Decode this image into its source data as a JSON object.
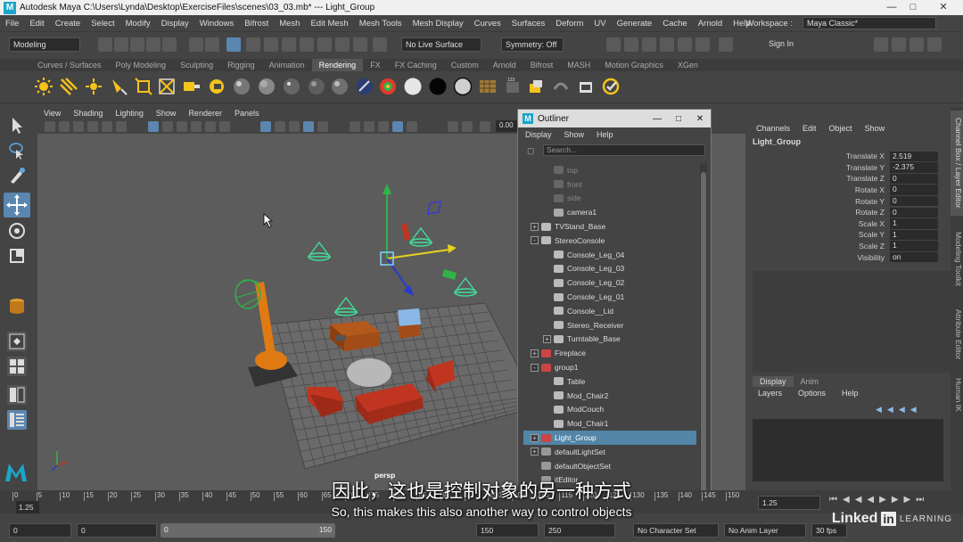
{
  "window": {
    "title": "Autodesk Maya  C:\\Users\\Lynda\\Desktop\\ExerciseFiles\\scenes\\03_03.mb*  ---  Light_Group",
    "logo": "M"
  },
  "menubar": [
    "File",
    "Edit",
    "Create",
    "Select",
    "Modify",
    "Display",
    "Windows",
    "Bifrost",
    "Mesh",
    "Edit Mesh",
    "Mesh Tools",
    "Mesh Display",
    "Curves",
    "Surfaces",
    "Deform",
    "UV",
    "Generate",
    "Cache",
    "Arnold",
    "Help"
  ],
  "workspace": {
    "label": "Workspace :",
    "value": "Maya Classic*"
  },
  "status": {
    "mode": "Modeling",
    "live_surface": "No Live Surface",
    "symmetry": "Symmetry: Off",
    "sign_in": "Sign In"
  },
  "shelf_tabs": [
    "Curves / Surfaces",
    "Poly Modeling",
    "Sculpting",
    "Rigging",
    "Animation",
    "Rendering",
    "FX",
    "FX Caching",
    "Custom",
    "Arnold",
    "Bifrost",
    "MASH",
    "Motion Graphics",
    "XGen"
  ],
  "shelf_active": "Rendering",
  "viewport": {
    "menu": [
      "View",
      "Shading",
      "Lighting",
      "Show",
      "Renderer",
      "Panels"
    ],
    "label": "persp",
    "value": "0.00"
  },
  "outliner": {
    "title": "Outliner",
    "menu": [
      "Display",
      "Show",
      "Help"
    ],
    "search_placeholder": "Search...",
    "items": [
      {
        "label": "top",
        "dim": true,
        "indent": 1
      },
      {
        "label": "front",
        "dim": true,
        "indent": 1
      },
      {
        "label": "side",
        "dim": true,
        "indent": 1
      },
      {
        "label": "camera1",
        "indent": 1
      },
      {
        "label": "TVStand_Base",
        "indent": 0,
        "exp": "+"
      },
      {
        "label": "StereoConsole",
        "indent": 0,
        "exp": "-"
      },
      {
        "label": "Console_Leg_04",
        "indent": 1
      },
      {
        "label": "Console_Leg_03",
        "indent": 1
      },
      {
        "label": "Console_Leg_02",
        "indent": 1
      },
      {
        "label": "Console_Leg_01",
        "indent": 1
      },
      {
        "label": "Console__Lid",
        "indent": 1
      },
      {
        "label": "Stereo_Receiver",
        "indent": 1
      },
      {
        "label": "Turntable_Base",
        "indent": 1,
        "exp": "+"
      },
      {
        "label": "Fireplace",
        "indent": 0,
        "exp": "+"
      },
      {
        "label": "group1",
        "indent": 0,
        "exp": "-"
      },
      {
        "label": "Table",
        "indent": 1
      },
      {
        "label": "Mod_Chair2",
        "indent": 1
      },
      {
        "label": "ModCouch",
        "indent": 1
      },
      {
        "label": "Mod_Chair1",
        "indent": 1
      },
      {
        "label": "Light_Group",
        "indent": 0,
        "exp": "+",
        "sel": true
      },
      {
        "label": "defaultLightSet",
        "indent": 0,
        "exp": "+"
      },
      {
        "label": "defaultObjectSet",
        "indent": 0
      },
      {
        "label": "itEditor",
        "indent": 0
      }
    ]
  },
  "channelbox": {
    "menu": [
      "Channels",
      "Edit",
      "Object",
      "Show"
    ],
    "object": "Light_Group",
    "attrs": [
      {
        "name": "Translate X",
        "value": "2.519"
      },
      {
        "name": "Translate Y",
        "value": "-2.375"
      },
      {
        "name": "Translate Z",
        "value": "0"
      },
      {
        "name": "Rotate X",
        "value": "0"
      },
      {
        "name": "Rotate Y",
        "value": "0"
      },
      {
        "name": "Rotate Z",
        "value": "0"
      },
      {
        "name": "Scale X",
        "value": "1"
      },
      {
        "name": "Scale Y",
        "value": "1"
      },
      {
        "name": "Scale Z",
        "value": "1"
      },
      {
        "name": "Visibility",
        "value": "on"
      }
    ],
    "layer_tabs": [
      "Display",
      "Anim"
    ],
    "layer_menu": [
      "Layers",
      "Options",
      "Help"
    ]
  },
  "side_tabs": [
    "Channel Box / Layer Editor",
    "Modeling Toolkit",
    "Attribute Editor",
    "Human IK"
  ],
  "timeline": {
    "ticks": [
      "0",
      "5",
      "10",
      "15",
      "20",
      "25",
      "30",
      "35",
      "40",
      "45",
      "50",
      "55",
      "60",
      "65",
      "70",
      "75",
      "80",
      "85",
      "90",
      "95",
      "100",
      "105",
      "110",
      "115",
      "120",
      "125",
      "130",
      "135",
      "140",
      "145",
      "150"
    ],
    "current": "1.25",
    "current_field": "1.25"
  },
  "range": {
    "start": "0",
    "anim_start": "0",
    "slider_start": "0",
    "slider_end": "150",
    "end": "150",
    "anim_end": "250",
    "char_set": "No Character Set",
    "anim_layer": "No Anim Layer",
    "fps": "30 fps"
  },
  "subtitles": {
    "zh": "因此，这也是控制对象的另一种方式",
    "en": "So, this makes this also another way to control objects"
  },
  "watermark": {
    "brand": "Linked",
    "in": "in",
    "learning": "LEARNING"
  },
  "colors": {
    "selection": "#5285a6",
    "wire_green": "#3fe09a",
    "orange": "#e07a12",
    "red_furniture": "#c0351f"
  }
}
